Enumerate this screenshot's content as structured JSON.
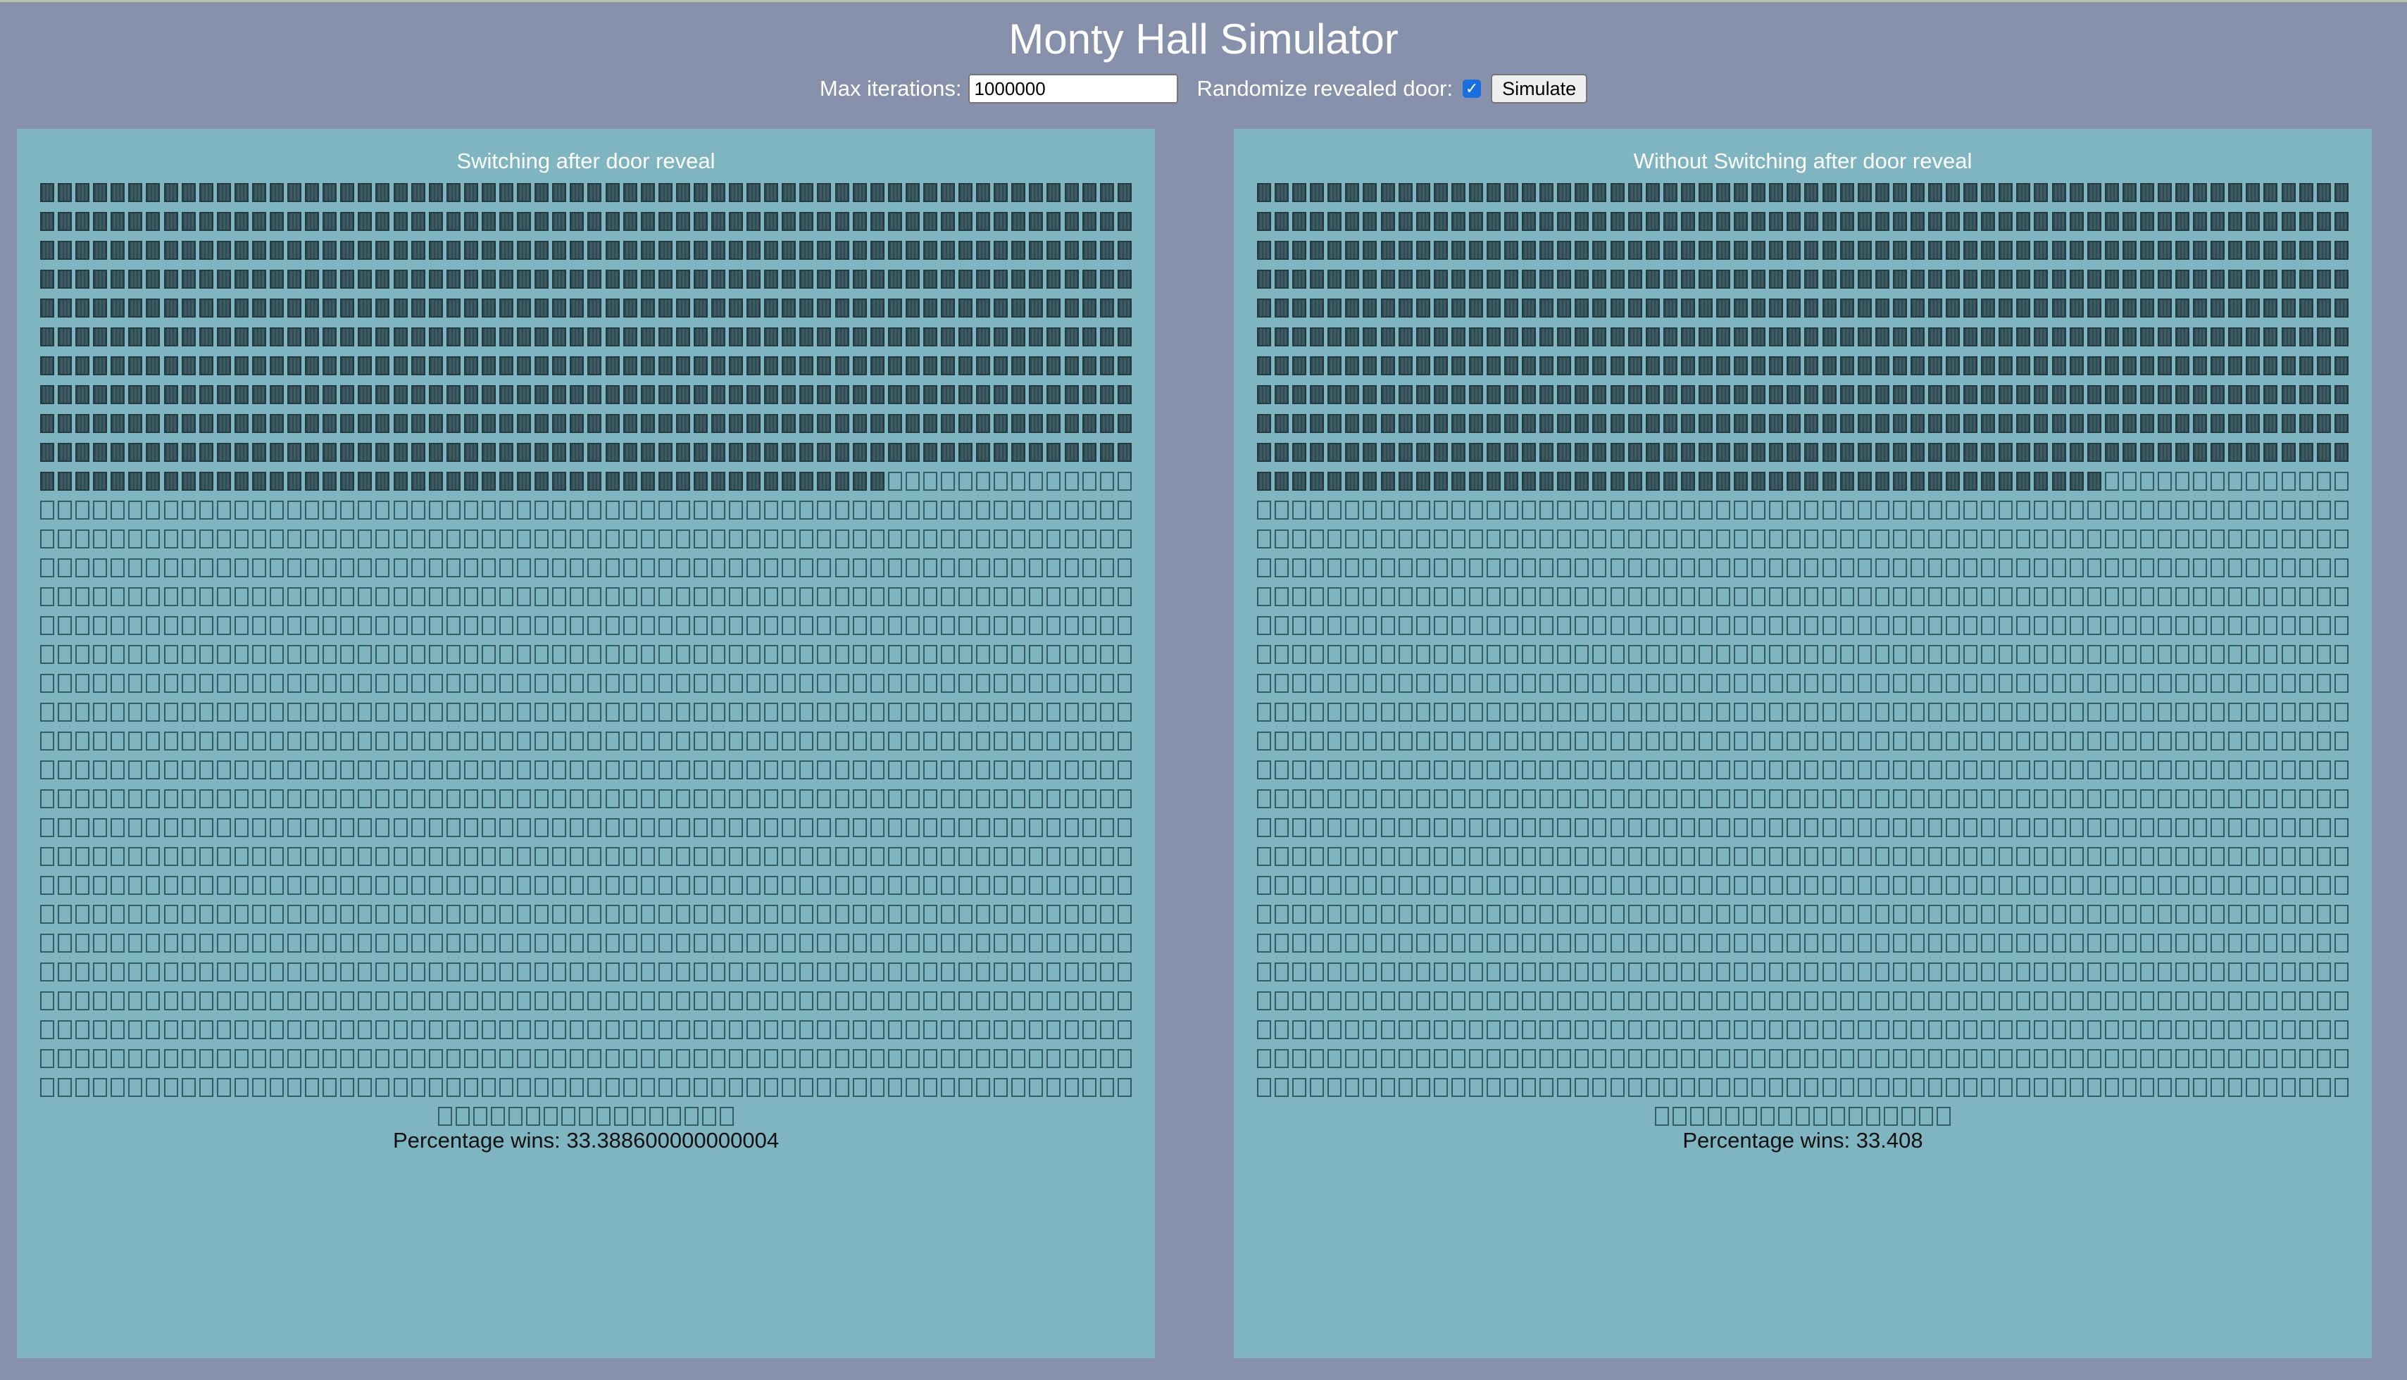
{
  "app": {
    "title": "Monty Hall Simulator"
  },
  "controls": {
    "max_iterations_label": "Max iterations:",
    "max_iterations_value": "1000000",
    "randomize_label": "Randomize revealed door:",
    "randomize_checked": true,
    "simulate_label": "Simulate"
  },
  "panels": [
    {
      "title": "Switching after door reveal",
      "percentage_label": "Percentage wins: 33.388600000000004",
      "grid": {
        "full_rows": 32,
        "columns": 62,
        "tail_cells": 17,
        "filled_fraction": 0.333886
      }
    },
    {
      "title": "Without Switching after door reveal",
      "percentage_label": "Percentage wins: 33.408",
      "grid": {
        "full_rows": 32,
        "columns": 62,
        "tail_cells": 17,
        "filled_fraction": 0.33408
      }
    }
  ],
  "colors": {
    "background": "#8791ab",
    "panel": "#7fb5c0",
    "cell_filled": "#35525a",
    "cell_border": "#355d66"
  }
}
